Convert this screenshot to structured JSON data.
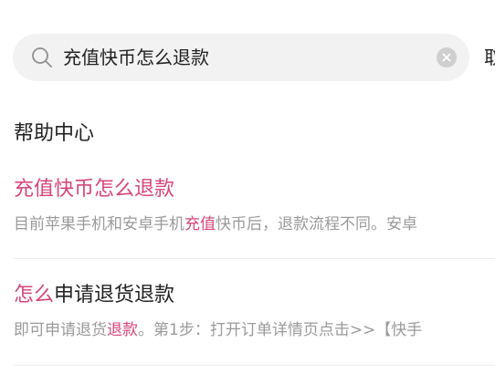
{
  "search": {
    "query": "充值快币怎么退款",
    "cancel_label": "取"
  },
  "section_title": "帮助中心",
  "results": [
    {
      "title_hl": "充值快币怎么退款",
      "title_rest": "",
      "snippet_pre": "目前苹果手机和安卓手机",
      "snippet_hl": "充值",
      "snippet_post": "快币后，退款流程不同。安卓"
    },
    {
      "title_hl": "怎么",
      "title_rest": "申请退货退款",
      "snippet_pre": "即可申请退货",
      "snippet_hl": "退款",
      "snippet_post": "。第1步：打开订单详情页点击>>【快手"
    }
  ],
  "colors": {
    "highlight": "#d6457a",
    "snippet_text": "#9a9a9a",
    "search_bg": "#f2f2f2"
  },
  "icons": {
    "search": "search-icon",
    "clear": "clear-icon"
  }
}
